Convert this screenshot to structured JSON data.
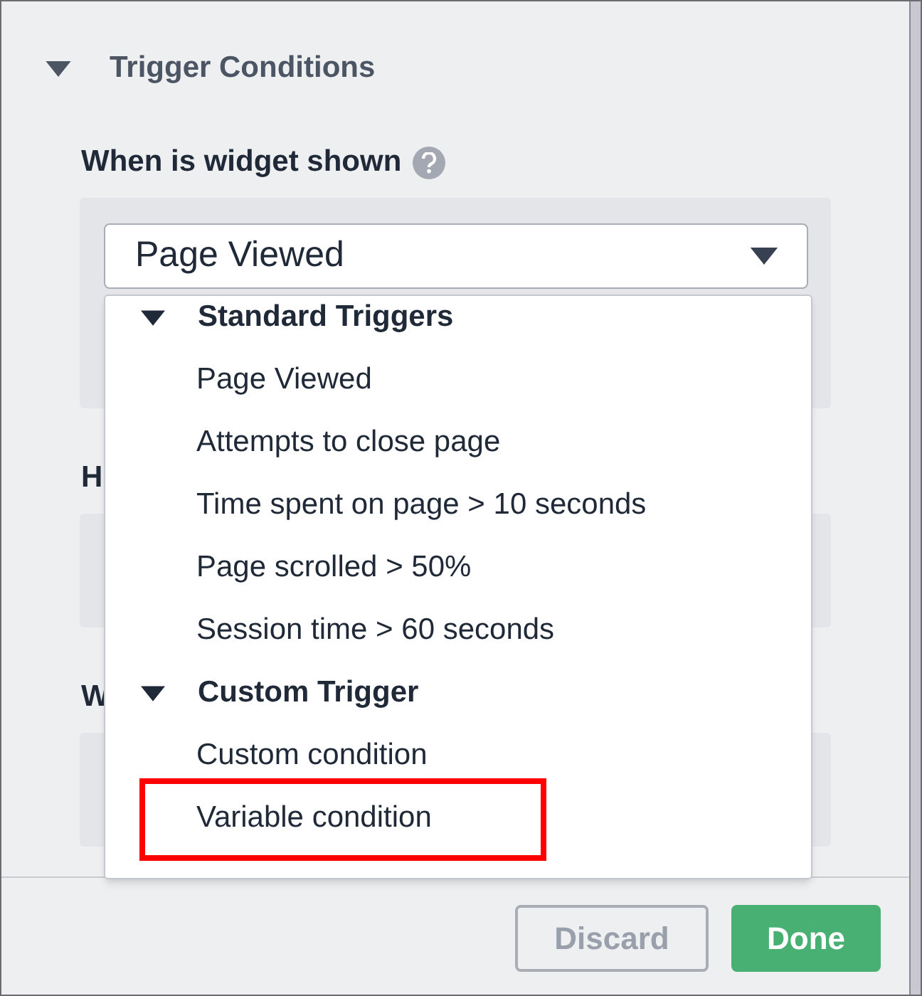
{
  "section": {
    "title": "Trigger Conditions",
    "expanded": true
  },
  "fields": [
    {
      "label": "When is widget shown",
      "help": true
    },
    {
      "label": "H",
      "help": false
    },
    {
      "label": "W",
      "help": false
    }
  ],
  "select": {
    "value": "Page Viewed"
  },
  "dropdown": {
    "groups": [
      {
        "title": "Standard Triggers",
        "expanded": true,
        "items": [
          {
            "label": "Page Viewed",
            "highlighted": false
          },
          {
            "label": "Attempts to close page",
            "highlighted": false
          },
          {
            "label": "Time spent on page > 10 seconds",
            "highlighted": false
          },
          {
            "label": "Page scrolled > 50%",
            "highlighted": false
          },
          {
            "label": "Session time > 60 seconds",
            "highlighted": false
          }
        ]
      },
      {
        "title": "Custom Trigger",
        "expanded": true,
        "items": [
          {
            "label": "Custom condition",
            "highlighted": false
          },
          {
            "label": "Variable condition",
            "highlighted": true
          }
        ]
      }
    ]
  },
  "buttons": [
    {
      "label": "Discard",
      "kind": "secondary"
    },
    {
      "label": "Done",
      "kind": "primary"
    }
  ]
}
